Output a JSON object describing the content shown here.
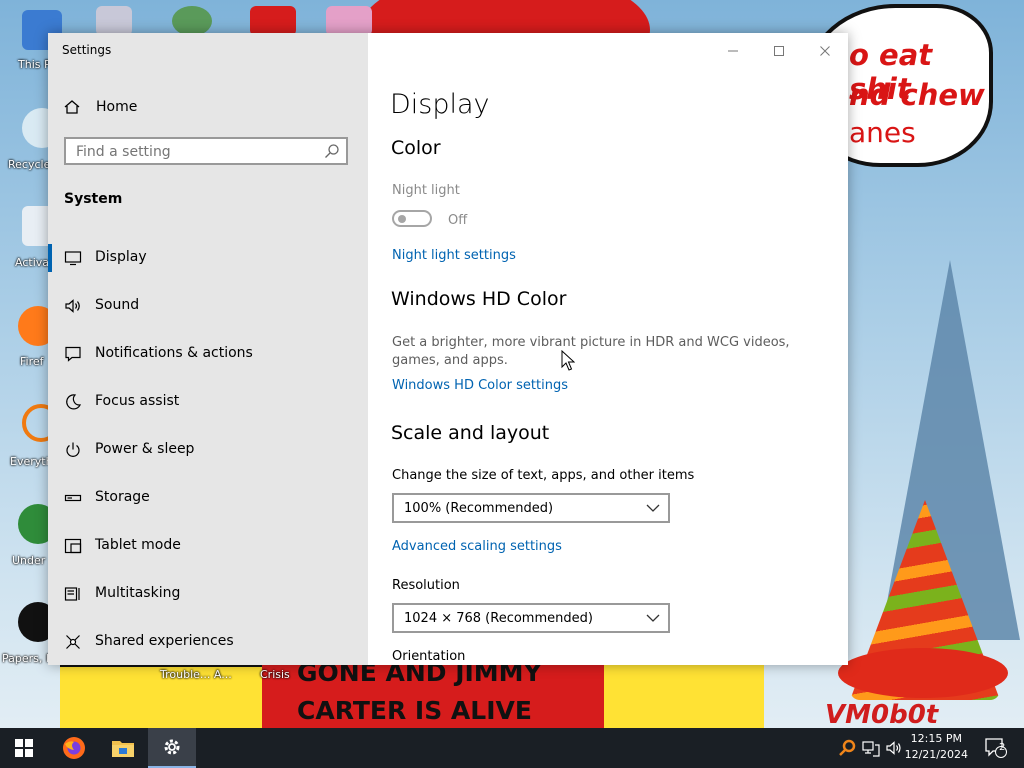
{
  "desktop": {
    "speech_lines": [
      "o eat shit",
      "nd chew",
      "anes"
    ],
    "banner_lines": [
      "GONE AND JIMMY",
      "CARTER IS ALIVE"
    ],
    "watermark": "VM0b0t",
    "icons": [
      {
        "label": "This P"
      },
      {
        "label": "Recycle"
      },
      {
        "label": "Activa"
      },
      {
        "label": "Firef"
      },
      {
        "label": "Everyth"
      },
      {
        "label": "Under"
      },
      {
        "label": "Papers, P"
      },
      {
        "label": "Trouble... A..."
      },
      {
        "label": "Crisis"
      }
    ]
  },
  "window": {
    "title": "Settings",
    "controls": {
      "minimize": "–",
      "maximize": "☐",
      "close": "✕"
    }
  },
  "sidebar": {
    "home_label": "Home",
    "search_placeholder": "Find a setting",
    "section": "System",
    "items": [
      {
        "label": "Display",
        "icon": "monitor-icon"
      },
      {
        "label": "Sound",
        "icon": "speaker-icon"
      },
      {
        "label": "Notifications & actions",
        "icon": "message-icon"
      },
      {
        "label": "Focus assist",
        "icon": "moon-icon"
      },
      {
        "label": "Power & sleep",
        "icon": "power-icon"
      },
      {
        "label": "Storage",
        "icon": "drive-icon"
      },
      {
        "label": "Tablet mode",
        "icon": "tablet-icon"
      },
      {
        "label": "Multitasking",
        "icon": "multitask-icon"
      },
      {
        "label": "Shared experiences",
        "icon": "share-icon"
      }
    ]
  },
  "content": {
    "title": "Display",
    "color": {
      "heading": "Color",
      "night_light_label": "Night light",
      "night_light_state": "Off",
      "night_light_link": "Night light settings"
    },
    "hdr": {
      "heading": "Windows HD Color",
      "description": "Get a brighter, more vibrant picture in HDR and WCG videos, games, and apps.",
      "link": "Windows HD Color settings"
    },
    "scale": {
      "heading": "Scale and layout",
      "size_label": "Change the size of text, apps, and other items",
      "size_value": "100% (Recommended)",
      "advanced_link": "Advanced scaling settings",
      "resolution_label": "Resolution",
      "resolution_value": "1024 × 768 (Recommended)",
      "orientation_label": "Orientation"
    }
  },
  "taskbar": {
    "time": "12:15 PM",
    "date": "12/21/2024",
    "notification_count": "2"
  }
}
